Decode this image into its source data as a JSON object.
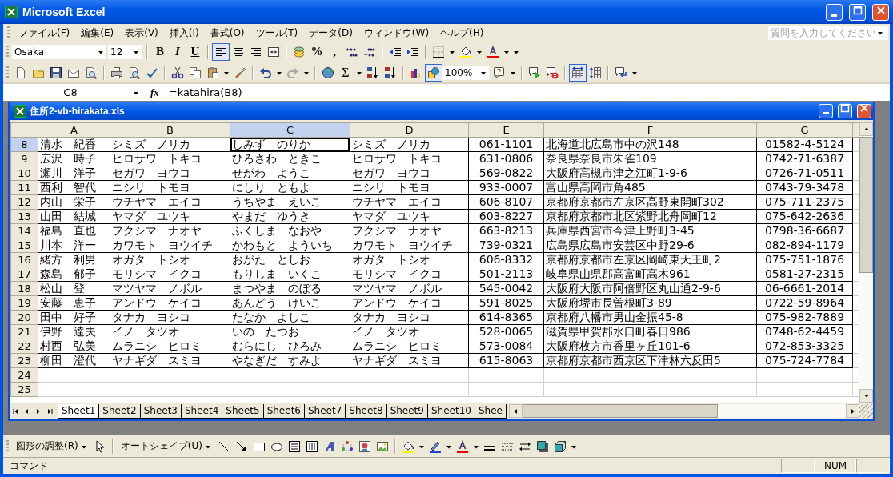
{
  "window": {
    "title": "Microsoft Excel"
  },
  "menu": [
    {
      "label": "ファイル(F)"
    },
    {
      "label": "編集(E)"
    },
    {
      "label": "表示(V)"
    },
    {
      "label": "挿入(I)"
    },
    {
      "label": "書式(O)"
    },
    {
      "label": "ツール(T)"
    },
    {
      "label": "データ(D)"
    },
    {
      "label": "ウィンドウ(W)"
    },
    {
      "label": "ヘルプ(H)"
    }
  ],
  "help_search": {
    "placeholder": "質問を入力してください"
  },
  "formatting_toolbar": {
    "font": "Osaka",
    "font_size": "12",
    "bold": "B",
    "italic": "I",
    "underline": "U",
    "align_left_pressed": true,
    "percent": "%",
    "comma": ","
  },
  "standard_toolbar": {
    "autosum": "Σ",
    "drawing_pressed": true,
    "zoom": "100%",
    "autofit_pressed": true
  },
  "formula_bar": {
    "name_box": "C8",
    "function_label": "fx",
    "formula": "=katahira(B8)"
  },
  "workbook": {
    "title": "住所2-vb-hirakata.xls",
    "columns": [
      {
        "label": "A",
        "kind": "text",
        "selected": false
      },
      {
        "label": "B",
        "kind": "text",
        "selected": false
      },
      {
        "label": "C",
        "kind": "text",
        "selected": true
      },
      {
        "label": "D",
        "kind": "text",
        "selected": false
      },
      {
        "label": "E",
        "kind": "number",
        "selected": false
      },
      {
        "label": "F",
        "kind": "text",
        "selected": false
      },
      {
        "label": "G",
        "kind": "number",
        "selected": false
      }
    ],
    "rows": [
      {
        "number": "8",
        "selected": true,
        "cells": [
          "清水　紀香",
          "シミズ　ノリカ",
          "しみず　のりか",
          "シミズ　ノリカ",
          "061-1101",
          "北海道北広島市中の沢148",
          "01582-4-5124"
        ]
      },
      {
        "number": "9",
        "selected": false,
        "cells": [
          "広沢　時子",
          "ヒロサワ　トキコ",
          "ひろさわ　ときこ",
          "ヒロサワ　トキコ",
          "631-0806",
          "奈良県奈良市朱雀109",
          "0742-71-6387"
        ]
      },
      {
        "number": "10",
        "selected": false,
        "cells": [
          "瀬川　洋子",
          "セガワ　ヨウコ",
          "せがわ　ようこ",
          "セガワ　ヨウコ",
          "569-0822",
          "大阪府高槻市津之江町1-9-6",
          "0726-71-0511"
        ]
      },
      {
        "number": "11",
        "selected": false,
        "cells": [
          "西利　智代",
          "ニシリ　トモヨ",
          "にしり　ともよ",
          "ニシリ　トモヨ",
          "933-0007",
          "富山県高岡市角485",
          "0743-79-3478"
        ]
      },
      {
        "number": "12",
        "selected": false,
        "cells": [
          "内山　栄子",
          "ウチヤマ　エイコ",
          "うちやま　えいこ",
          "ウチヤマ　エイコ",
          "606-8107",
          "京都府京都市左京区高野東開町302",
          "075-711-2375"
        ]
      },
      {
        "number": "13",
        "selected": false,
        "cells": [
          "山田　結城",
          "ヤマダ　ユウキ",
          "やまだ　ゆうき",
          "ヤマダ　ユウキ",
          "603-8227",
          "京都府京都市北区紫野北舟岡町12",
          "075-642-2636"
        ]
      },
      {
        "number": "14",
        "selected": false,
        "cells": [
          "福島　直也",
          "フクシマ　ナオヤ",
          "ふくしま　なおや",
          "フクシマ　ナオヤ",
          "663-8213",
          "兵庫県西宮市今津上野町3-45",
          "0798-36-6687"
        ]
      },
      {
        "number": "15",
        "selected": false,
        "cells": [
          "川本　洋一",
          "カワモト　ヨウイチ",
          "かわもと　よういち",
          "カワモト　ヨウイチ",
          "739-0321",
          "広島県広島市安芸区中野29-6",
          "082-894-1179"
        ]
      },
      {
        "number": "16",
        "selected": false,
        "cells": [
          "緒方　利男",
          "オガタ　トシオ",
          "おがた　としお",
          "オガタ　トシオ",
          "606-8332",
          "京都府京都市左京区岡崎東天王町2",
          "075-751-1876"
        ]
      },
      {
        "number": "17",
        "selected": false,
        "cells": [
          "森島　郁子",
          "モリシマ　イクコ",
          "もりしま　いくこ",
          "モリシマ　イクコ",
          "501-2113",
          "岐阜県山県郡高富町高木961",
          "0581-27-2315"
        ]
      },
      {
        "number": "18",
        "selected": false,
        "cells": [
          "松山　登",
          "マツヤマ　ノボル",
          "まつやま　のぼる",
          "マツヤマ　ノボル",
          "545-0042",
          "大阪府大阪市阿倍野区丸山通2-9-6",
          "06-6661-2014"
        ]
      },
      {
        "number": "19",
        "selected": false,
        "cells": [
          "安藤　恵子",
          "アンドウ　ケイコ",
          "あんどう　けいこ",
          "アンドウ　ケイコ",
          "591-8025",
          "大阪府堺市長曽根町3-89",
          "0722-59-8964"
        ]
      },
      {
        "number": "20",
        "selected": false,
        "cells": [
          "田中　好子",
          "タナカ　ヨシコ",
          "たなか　よしこ",
          "タナカ　ヨシコ",
          "614-8365",
          "京都府八幡市男山金振45-8",
          "075-982-7889"
        ]
      },
      {
        "number": "21",
        "selected": false,
        "cells": [
          "伊野　達夫",
          "イノ　タツオ",
          "いの　たつお",
          "イノ　タツオ",
          "528-0065",
          "滋賀県甲賀郡水口町春日986",
          "0748-62-4459"
        ]
      },
      {
        "number": "22",
        "selected": false,
        "cells": [
          "村西　弘美",
          "ムラニシ　ヒロミ",
          "むらにし　ひろみ",
          "ムラニシ　ヒロミ",
          "573-0084",
          "大阪府枚方市香里ヶ丘101-6",
          "072-853-3325"
        ]
      },
      {
        "number": "23",
        "selected": false,
        "cells": [
          "柳田　澄代",
          "ヤナギダ　スミヨ",
          "やなぎだ　すみよ",
          "ヤナギダ　スミヨ",
          "615-8063",
          "京都府京都市西京区下津林六反田5",
          "075-724-7784"
        ]
      },
      {
        "number": "24",
        "selected": false,
        "cells": []
      },
      {
        "number": "25",
        "selected": false,
        "cells": []
      }
    ],
    "sheet_tabs": [
      {
        "label": "Sheet1",
        "selected": true
      },
      {
        "label": "Sheet2",
        "selected": false
      },
      {
        "label": "Sheet3",
        "selected": false
      },
      {
        "label": "Sheet4",
        "selected": false
      },
      {
        "label": "Sheet5",
        "selected": false
      },
      {
        "label": "Sheet6",
        "selected": false
      },
      {
        "label": "Sheet7",
        "selected": false
      },
      {
        "label": "Sheet8",
        "selected": false
      },
      {
        "label": "Sheet9",
        "selected": false
      },
      {
        "label": "Sheet10",
        "selected": false
      },
      {
        "label": "Shee",
        "selected": false
      }
    ]
  },
  "drawing_toolbar": {
    "draw_menu": "図形の調整(R)",
    "autoshapes_menu": "オートシェイプ(U)"
  },
  "status_bar": {
    "mode": "コマンド",
    "num": "NUM"
  }
}
